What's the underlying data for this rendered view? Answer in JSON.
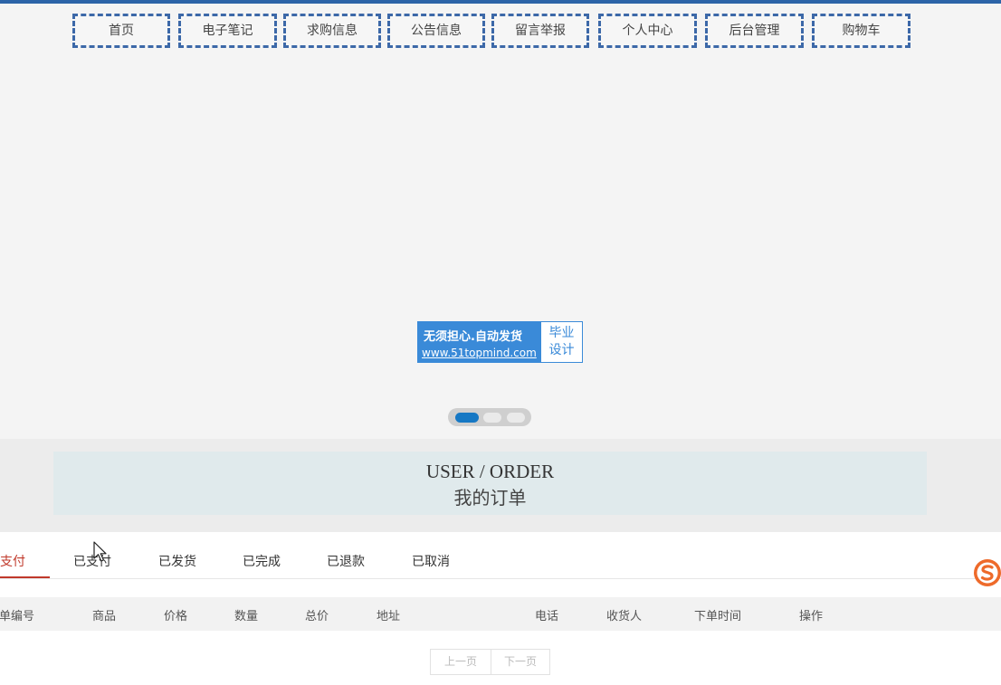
{
  "nav": {
    "items": [
      "首页",
      "电子笔记",
      "求购信息",
      "公告信息",
      "留言举报",
      "个人中心",
      "后台管理",
      "购物车"
    ]
  },
  "banner": {
    "logo_line1": "无须担心.自动发货",
    "logo_line2": "www.51topmind.com",
    "logo_right_top": "毕业",
    "logo_right_bottom": "设计",
    "slide_count": 3,
    "active_slide": 1
  },
  "section": {
    "title_en": "USER / ORDER",
    "title_cn": "我的订单"
  },
  "orders": {
    "tabs": [
      "未支付",
      "已支付",
      "已发货",
      "已完成",
      "已退款",
      "已取消"
    ],
    "active_tab": 0,
    "columns": [
      "订单编号",
      "商品",
      "价格",
      "数量",
      "总价",
      "地址",
      "电话",
      "收货人",
      "下单时间",
      "操作"
    ],
    "pager": {
      "prev": "上一页",
      "next": "下一页"
    }
  },
  "colors": {
    "accent": "#c0392b",
    "nav_border": "#3c68a8",
    "logo_blue": "#3a8ad8",
    "active_dot": "#1678c4"
  }
}
